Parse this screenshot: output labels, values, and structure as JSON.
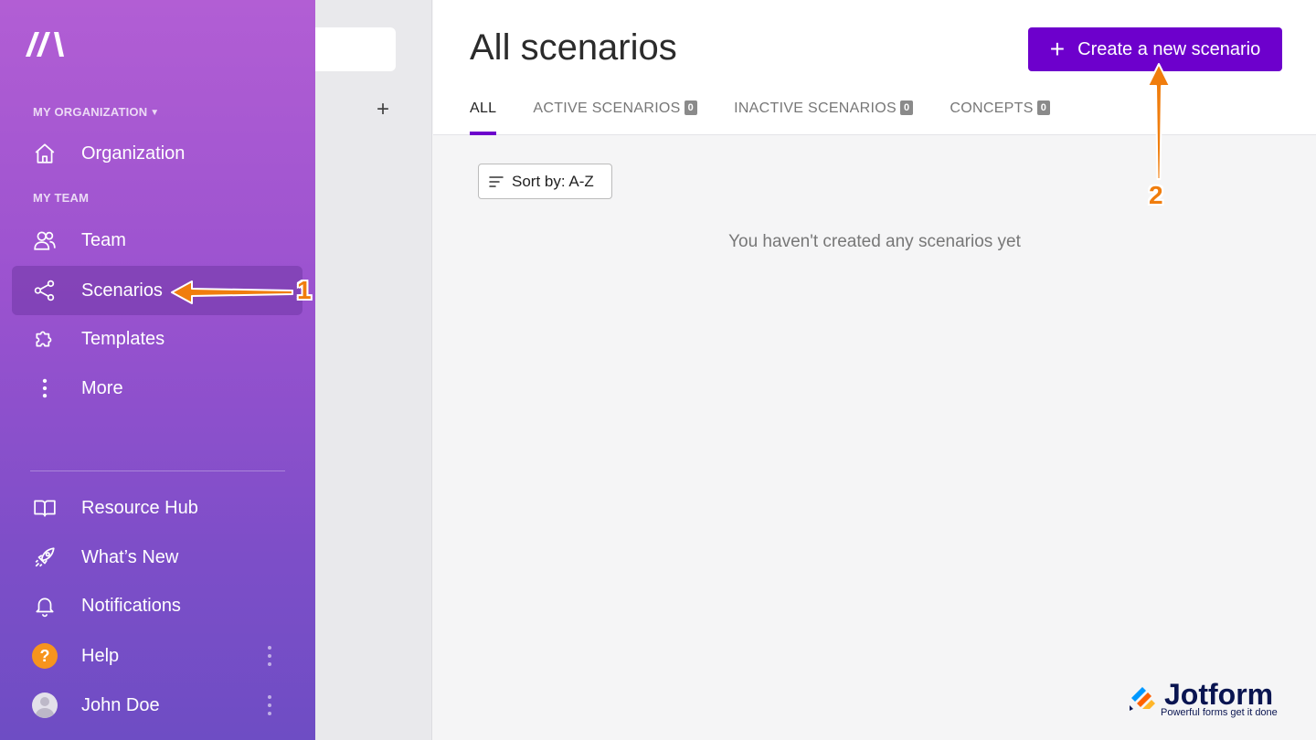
{
  "sidebar": {
    "org_label": "MY ORGANIZATION",
    "team_label": "MY TEAM",
    "items": [
      {
        "label": "Organization",
        "icon": "home-icon"
      },
      {
        "label": "Team",
        "icon": "users-icon"
      },
      {
        "label": "Scenarios",
        "icon": "share-nodes-icon"
      },
      {
        "label": "Templates",
        "icon": "puzzle-icon"
      },
      {
        "label": "More",
        "icon": "vertical-dots-icon"
      }
    ],
    "bottom_items": [
      {
        "label": "Resource Hub",
        "icon": "book-icon"
      },
      {
        "label": "What’s New",
        "icon": "rocket-icon"
      },
      {
        "label": "Notifications",
        "icon": "bell-icon"
      },
      {
        "label": "Help",
        "icon": "help-badge-icon",
        "badge": "?"
      },
      {
        "label": "John Doe",
        "icon": "avatar"
      }
    ]
  },
  "main": {
    "title": "All scenarios",
    "create_button": "Create a new scenario",
    "tabs": [
      {
        "label": "ALL",
        "count": null
      },
      {
        "label": "ACTIVE SCENARIOS",
        "count": "0"
      },
      {
        "label": "INACTIVE SCENARIOS",
        "count": "0"
      },
      {
        "label": "CONCEPTS",
        "count": "0"
      }
    ],
    "sort_label": "Sort by: A-Z",
    "empty_message": "You haven't created any scenarios yet"
  },
  "annotations": {
    "step1": "1",
    "step2": "2"
  },
  "watermark": {
    "brand": "Jotform",
    "tagline": "Powerful forms get it done"
  },
  "colors": {
    "accent": "#6d00cc",
    "annotation": "#f07d0d",
    "help_badge": "#f7941d"
  }
}
